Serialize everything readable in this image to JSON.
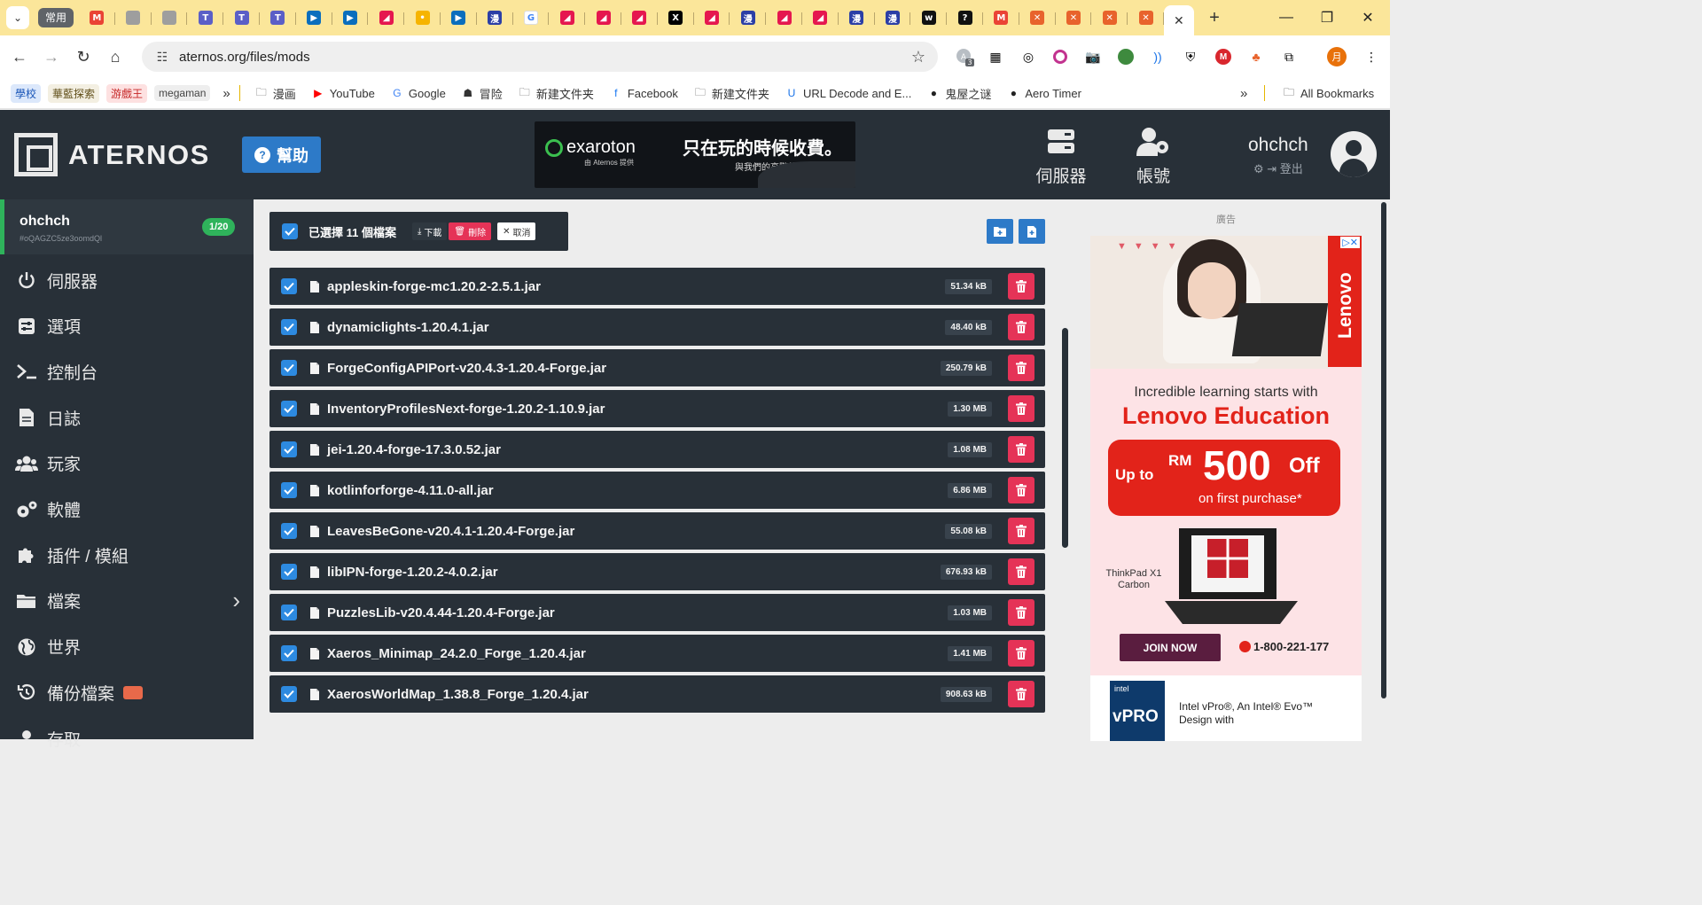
{
  "browser": {
    "tab_group_label": "常用",
    "tabs": [
      {
        "icon": "gmail-icon",
        "color": "#ea4335",
        "glyph": "M"
      },
      {
        "icon": "globe-icon",
        "color": "#9e9e9e",
        "glyph": ""
      },
      {
        "icon": "globe-icon",
        "color": "#9e9e9e",
        "glyph": ""
      },
      {
        "icon": "teams-icon",
        "color": "#5b5fc7",
        "glyph": "T"
      },
      {
        "icon": "teams-icon",
        "color": "#5b5fc7",
        "glyph": "T"
      },
      {
        "icon": "teams-icon",
        "color": "#5b5fc7",
        "glyph": "T"
      },
      {
        "icon": "video-icon",
        "color": "#0a6ebd",
        "glyph": "▶"
      },
      {
        "icon": "video-icon",
        "color": "#0a6ebd",
        "glyph": "▶"
      },
      {
        "icon": "bookmark-app-icon",
        "color": "#e5174f",
        "glyph": "◢"
      },
      {
        "icon": "keep-icon",
        "color": "#f6b400",
        "glyph": "•"
      },
      {
        "icon": "video-icon",
        "color": "#0a6ebd",
        "glyph": "▶"
      },
      {
        "icon": "manga-icon",
        "color": "#2c3fa6",
        "glyph": "漫"
      },
      {
        "icon": "google-icon",
        "color": "#ffffff",
        "glyph": "G"
      },
      {
        "icon": "bookmark-app-icon",
        "color": "#e5174f",
        "glyph": "◢"
      },
      {
        "icon": "bookmark-app-icon",
        "color": "#e5174f",
        "glyph": "◢"
      },
      {
        "icon": "bookmark-app-icon",
        "color": "#e5174f",
        "glyph": "◢"
      },
      {
        "icon": "x-icon",
        "color": "#000000",
        "glyph": "X"
      },
      {
        "icon": "bookmark-app-icon",
        "color": "#e5174f",
        "glyph": "◢"
      },
      {
        "icon": "manga-icon",
        "color": "#2c3fa6",
        "glyph": "漫"
      },
      {
        "icon": "bookmark-app-icon",
        "color": "#e5174f",
        "glyph": "◢"
      },
      {
        "icon": "bookmark-app-icon",
        "color": "#e5174f",
        "glyph": "◢"
      },
      {
        "icon": "manga-icon",
        "color": "#2c3fa6",
        "glyph": "漫"
      },
      {
        "icon": "manga-icon",
        "color": "#2c3fa6",
        "glyph": "漫"
      },
      {
        "icon": "webtoon-icon",
        "color": "#111111",
        "glyph": "w"
      },
      {
        "icon": "chatgpt-icon",
        "color": "#111111",
        "glyph": "?"
      },
      {
        "icon": "gmail-icon",
        "color": "#ea4335",
        "glyph": "M"
      },
      {
        "icon": "cat-icon",
        "color": "#e8632c",
        "glyph": "✕"
      },
      {
        "icon": "cat-icon",
        "color": "#e8632c",
        "glyph": "✕"
      },
      {
        "icon": "cat-icon",
        "color": "#e8632c",
        "glyph": "✕"
      },
      {
        "icon": "cat-icon",
        "color": "#e8632c",
        "glyph": "✕"
      }
    ],
    "address": "aternos.org/files/mods",
    "bookmarks": [
      {
        "label": "學校",
        "type": "chip",
        "bg": "#dce8fb",
        "color": "#1a56b8"
      },
      {
        "label": "華藍探索",
        "type": "chip",
        "bg": "#f3efe2",
        "color": "#5f4d17"
      },
      {
        "label": "游戲王",
        "type": "chip",
        "bg": "#fde1e1",
        "color": "#c62828"
      },
      {
        "label": "megaman",
        "type": "chip",
        "bg": "#eeeeee",
        "color": "#444444"
      }
    ],
    "bookmark_links": [
      {
        "label": "漫画",
        "icon": "folder-icon"
      },
      {
        "label": "YouTube",
        "icon": "youtube-icon"
      },
      {
        "label": "Google",
        "icon": "google-icon"
      },
      {
        "label": "冒险",
        "icon": "robot-icon"
      },
      {
        "label": "新建文件夹",
        "icon": "folder-icon"
      },
      {
        "label": "Facebook",
        "icon": "facebook-icon"
      },
      {
        "label": "新建文件夹",
        "icon": "folder-icon"
      },
      {
        "label": "URL Decode and E...",
        "icon": "url-icon"
      },
      {
        "label": "鬼屋之谜",
        "icon": "github-icon"
      },
      {
        "label": "Aero Timer",
        "icon": "github-icon"
      }
    ],
    "all_bookmarks": "All Bookmarks",
    "extension_badge": "3",
    "profile_initial": "月"
  },
  "header": {
    "logo_text": "ATERNOS",
    "help_label": "幫助",
    "ad": {
      "brand": "exaroton",
      "brand_sub": "由 Aternos 提供",
      "slogan": "只在玩的時候收費。",
      "slogan_sub": "與我們的高階的電競伺服器"
    },
    "nav": [
      {
        "label": "伺服器",
        "icon": "server-icon"
      },
      {
        "label": "帳號",
        "icon": "account-settings-icon"
      }
    ],
    "user": {
      "name": "ohchch",
      "logout": "登出"
    }
  },
  "sidebar": {
    "server": {
      "name": "ohchch",
      "id": "#oQAGZC5ze3oomdQl",
      "slots": "1/20"
    },
    "items": [
      {
        "label": "伺服器",
        "icon": "power-icon"
      },
      {
        "label": "選項",
        "icon": "options-icon"
      },
      {
        "label": "控制台",
        "icon": "terminal-icon"
      },
      {
        "label": "日誌",
        "icon": "log-file-icon"
      },
      {
        "label": "玩家",
        "icon": "players-icon"
      },
      {
        "label": "軟體",
        "icon": "gears-icon"
      },
      {
        "label": "插件 / 模組",
        "icon": "puzzle-icon"
      },
      {
        "label": "檔案",
        "icon": "folder-icon"
      },
      {
        "label": "世界",
        "icon": "globe-icon"
      },
      {
        "label": "備份檔案",
        "icon": "history-icon"
      },
      {
        "label": "存取",
        "icon": "access-icon"
      }
    ]
  },
  "files": {
    "selection_text": "已選擇 11 個檔案",
    "download": "下載",
    "delete": "刪除",
    "cancel": "取消",
    "list": [
      {
        "name": "appleskin-forge-mc1.20.2-2.5.1.jar",
        "size": "51.34 kB"
      },
      {
        "name": "dynamiclights-1.20.4.1.jar",
        "size": "48.40 kB"
      },
      {
        "name": "ForgeConfigAPIPort-v20.4.3-1.20.4-Forge.jar",
        "size": "250.79 kB"
      },
      {
        "name": "InventoryProfilesNext-forge-1.20.2-1.10.9.jar",
        "size": "1.30 MB"
      },
      {
        "name": "jei-1.20.4-forge-17.3.0.52.jar",
        "size": "1.08 MB"
      },
      {
        "name": "kotlinforforge-4.11.0-all.jar",
        "size": "6.86 MB"
      },
      {
        "name": "LeavesBeGone-v20.4.1-1.20.4-Forge.jar",
        "size": "55.08 kB"
      },
      {
        "name": "libIPN-forge-1.20.2-4.0.2.jar",
        "size": "676.93 kB"
      },
      {
        "name": "PuzzlesLib-v20.4.44-1.20.4-Forge.jar",
        "size": "1.03 MB"
      },
      {
        "name": "Xaeros_Minimap_24.2.0_Forge_1.20.4.jar",
        "size": "1.41 MB"
      },
      {
        "name": "XaerosWorldMap_1.38.8_Forge_1.20.4.jar",
        "size": "908.63 kB"
      }
    ]
  },
  "ad_column": {
    "label": "廣告",
    "brand": "Lenovo",
    "headline": "Incredible learning starts with",
    "headline_brand": "Lenovo Education",
    "offer_upto": "Up to",
    "offer_currency": "RM",
    "offer_amount": "500",
    "offer_off": "Off",
    "offer_sub": "on first purchase*",
    "product": "ThinkPad X1 Carbon",
    "join": "JOIN NOW",
    "phone": "1-800-221-177",
    "intel_logo": "intel",
    "intel_badge": "vPRO",
    "intel_text": "Intel vPro®, An Intel® Evo™ Design with"
  },
  "colors": {
    "dark": "#283038",
    "accent_blue": "#2d7ac8",
    "danger": "#e53357",
    "success": "#2fb35b"
  }
}
